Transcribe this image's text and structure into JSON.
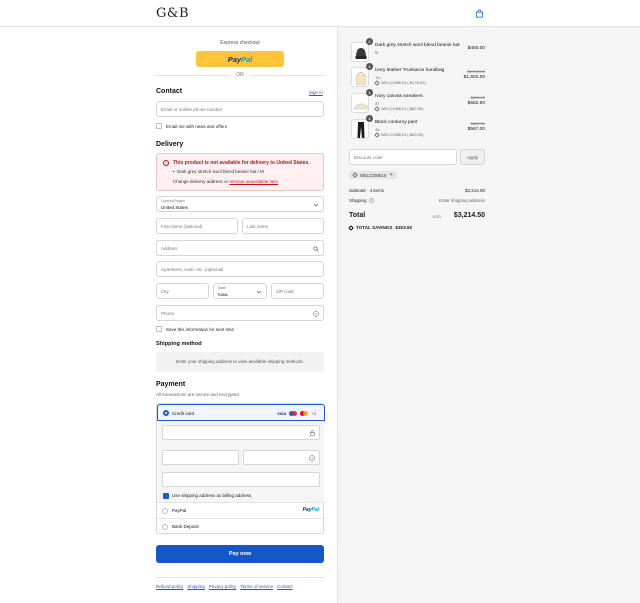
{
  "header": {
    "logo": "G&B",
    "cart_icon": "shopping-bag-icon"
  },
  "express": {
    "label": "Express checkout",
    "paypal_a": "Pay",
    "paypal_b": "Pal",
    "or": "OR"
  },
  "contact": {
    "title": "Contact",
    "sign_in": "Sign in",
    "email_placeholder": "Email or mobile phone number",
    "news_label": "Email me with news and offers"
  },
  "delivery": {
    "title": "Delivery",
    "error": {
      "title": "This product is not available for delivery to United States.",
      "item": "Dark grey stretch wool blend beanie hat / M",
      "action_prefix": "Change delivery address or ",
      "action_link": "remove unavailable item"
    },
    "country_label": "Country/Region",
    "country_value": "United States",
    "first_name": "First name (optional)",
    "last_name": "Last name",
    "address": "Address",
    "apartment": "Apartment, suite, etc. (optional)",
    "city": "City",
    "state_label": "State",
    "state_value": "Iowa",
    "zip": "ZIP code",
    "phone": "Phone",
    "save_info": "Save this information for next time"
  },
  "shipping": {
    "title": "Shipping method",
    "note": "Enter your shipping address to view available shipping methods."
  },
  "payment": {
    "title": "Payment",
    "desc": "All transactions are secure and encrypted.",
    "credit_card": "Credit card",
    "card_visa": "VISA",
    "card_more": "+3",
    "billing_same": "Use shipping address as billing address",
    "paypal": "PayPal",
    "paypal_logo_a": "Pay",
    "paypal_logo_b": "Pal",
    "bank": "Bank Deposit"
  },
  "pay_now": "Pay now",
  "footer": {
    "links": [
      "Refund policy",
      "Shipping",
      "Privacy policy",
      "Terms of service",
      "Contact"
    ]
  },
  "order": {
    "items": [
      {
        "qty": "1",
        "name": "Dark grey stretch wool blend beanie hat",
        "variant": "M",
        "discount": "",
        "old_price": "",
        "price": "$493.00"
      },
      {
        "qty": "1",
        "name": "Ivory leather Trunkaroo handbag",
        "variant": "TU",
        "discount": "WELCOME10 (-$178.00)",
        "old_price": "$1,780.00",
        "price": "$1,602.00"
      },
      {
        "qty": "1",
        "name": "Ivory canvas sneakers",
        "variant": "37",
        "discount": "WELCOME10 (-$62.50)",
        "old_price": "$625.00",
        "price": "$562.50"
      },
      {
        "qty": "1",
        "name": "Black corduroy pant",
        "variant": "46",
        "discount": "WELCOME10 (-$63.00)",
        "old_price": "$630.00",
        "price": "$567.00"
      }
    ],
    "discount_placeholder": "Discount code",
    "apply": "Apply",
    "applied_code": "WELCOME10",
    "subtotal_label": "Subtotal · 4 items",
    "subtotal_value": "$3,214.50",
    "shipping_label": "Shipping",
    "shipping_value": "Enter shipping address",
    "total_label": "Total",
    "currency": "USD",
    "total_value": "$3,214.50",
    "savings_label": "TOTAL SAVINGS",
    "savings_value": "$303.50"
  },
  "colors": {
    "accent": "#1357c9",
    "paypal_yellow": "#ffc439",
    "error": "#c1121f"
  }
}
